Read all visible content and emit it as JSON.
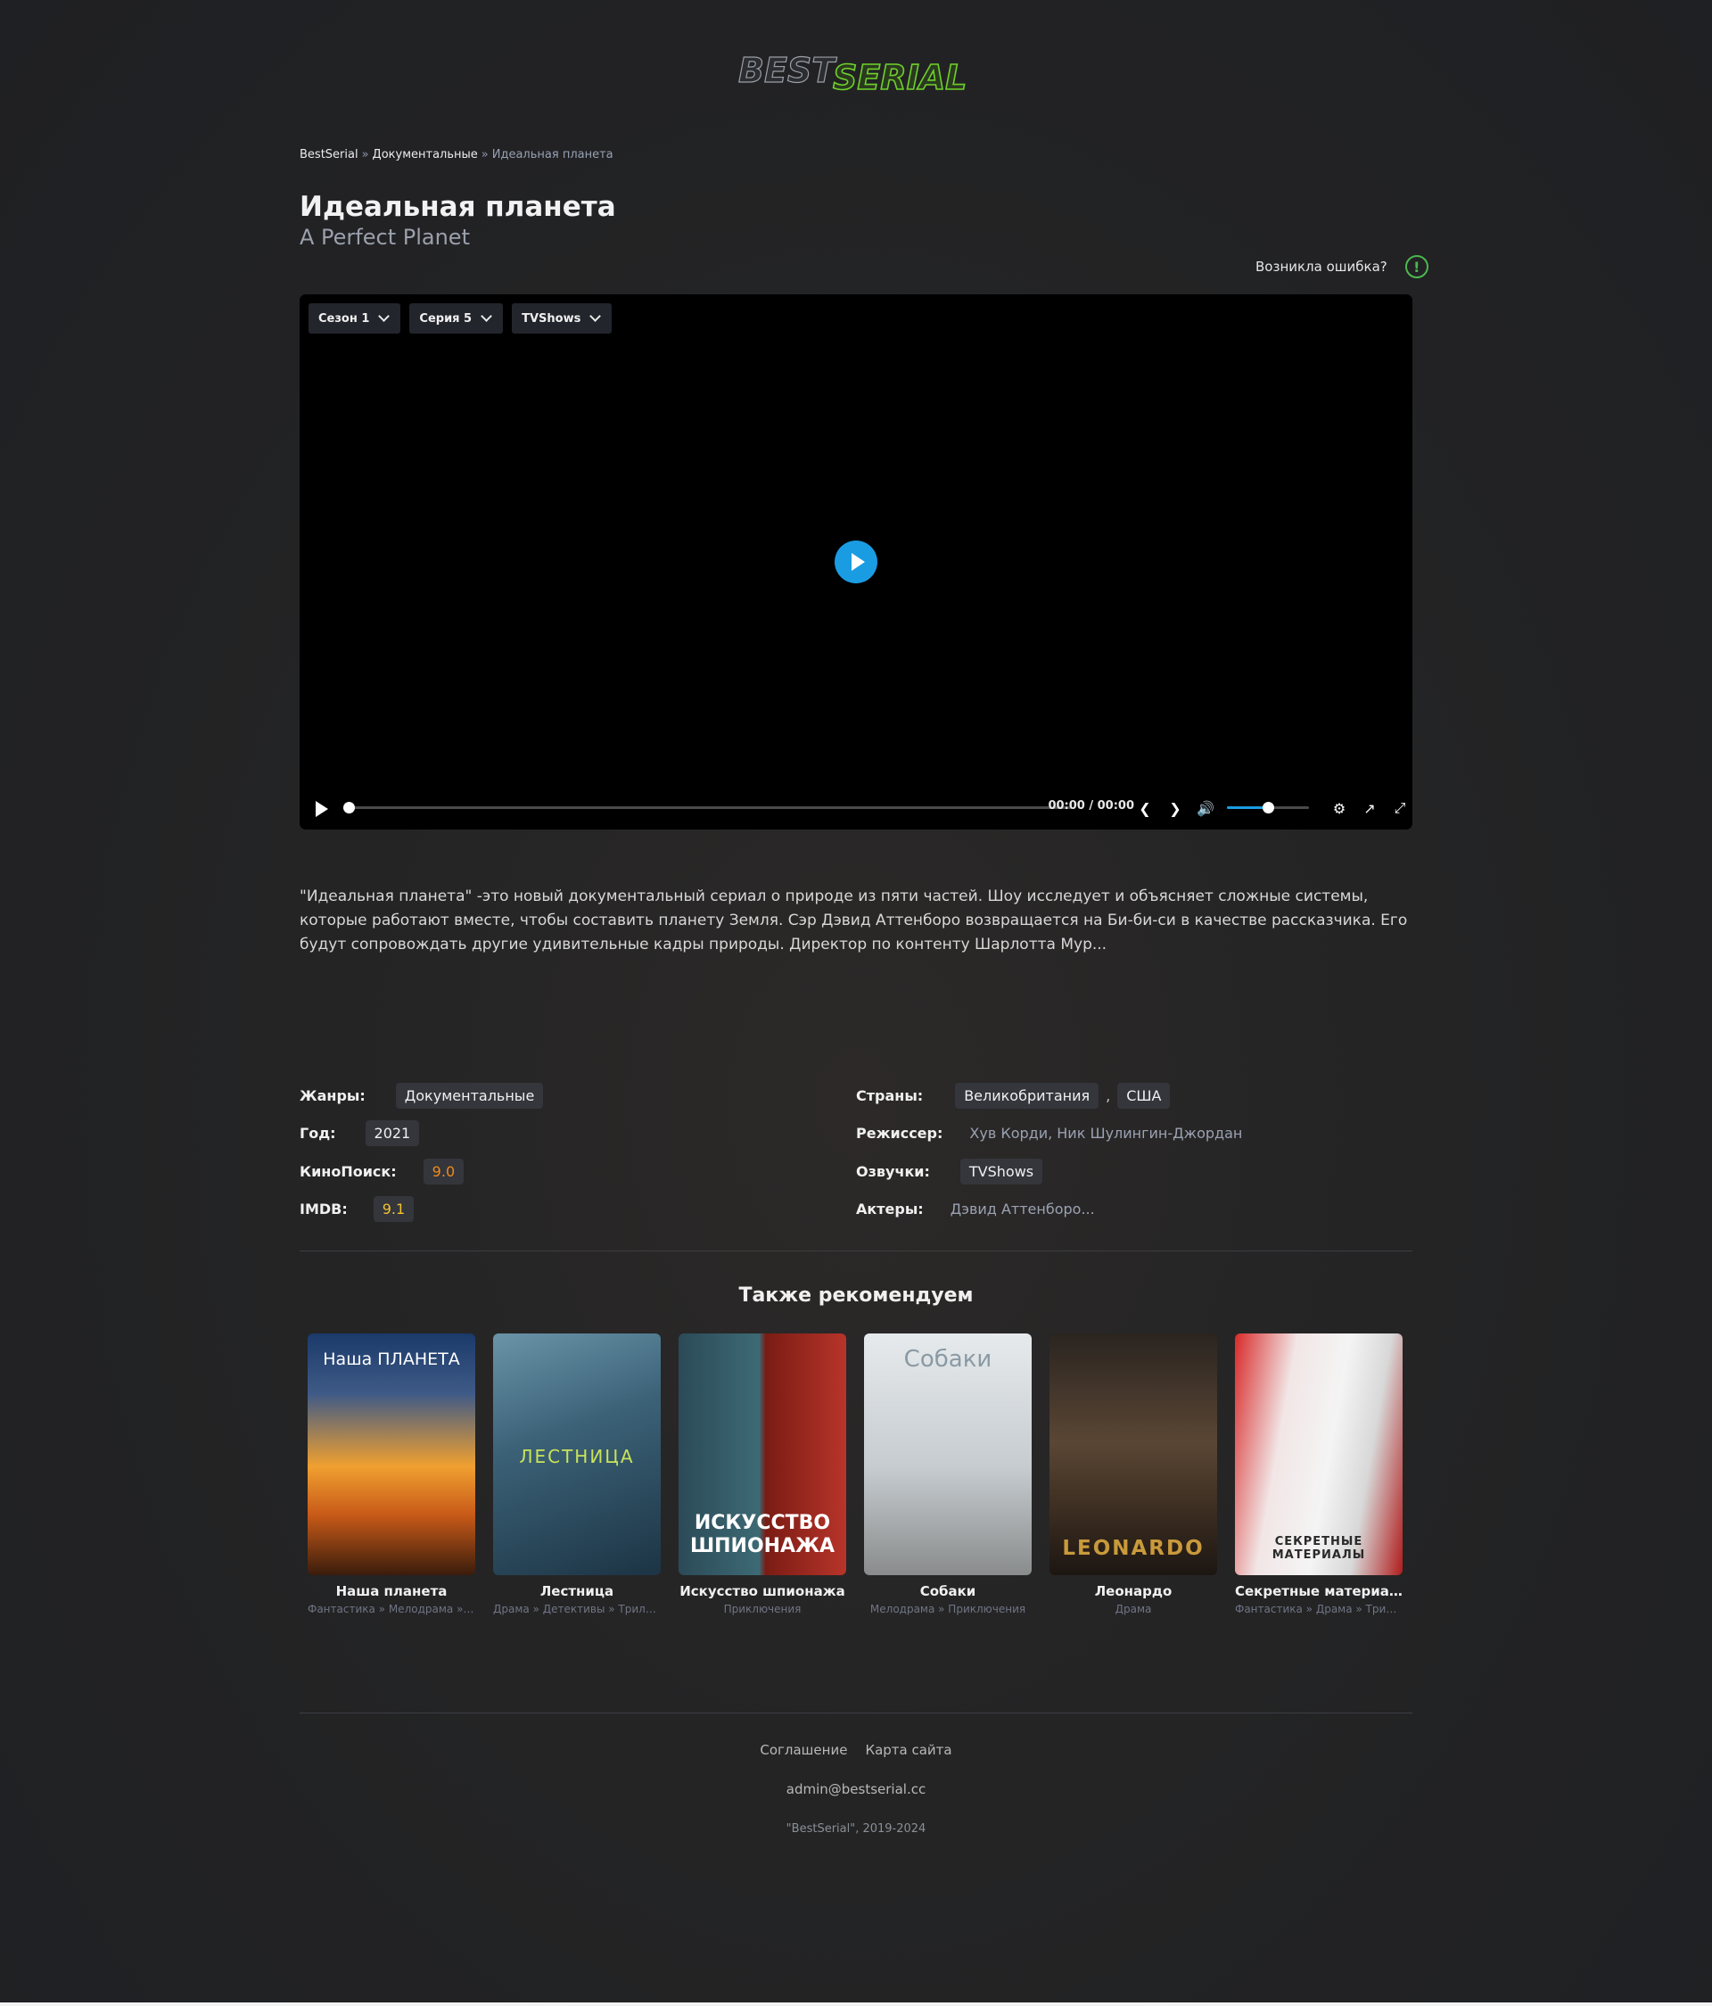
{
  "site": {
    "logo_left": "BEST",
    "logo_right": "SERIAL",
    "accent": "#4bb84f"
  },
  "breadcrumb": {
    "home": "BestSerial",
    "sep": "»",
    "category": "Документальные",
    "current": "Идеальная планета"
  },
  "title": "Идеальная планета",
  "original_title": "A Perfect Planet",
  "report": {
    "label": "Возникла ошибка?",
    "icon": "alert-circle-icon"
  },
  "player": {
    "season": "Сезон 1",
    "episode": "Серия 5",
    "voice": "TVShows",
    "time": "00:00 / 00:00",
    "progress": 0,
    "volume": 0.5,
    "accent": "#1a9ce3"
  },
  "description": "\"Идеальная планета\" -это новый документальный сериал о природе из пяти частей. Шоу исследует и объясняет сложные системы, которые работают вместе, чтобы составить планету Земля. Сэр Дэвид Аттенборо возвращается на Би-би-си в качестве рассказчика. Его будут сопровождать другие удивительные кадры природы. Директор по контенту Шарлотта Мур...",
  "info": {
    "genres_label": "Жанры:",
    "genre": "Документальные",
    "year_label": "Год:",
    "year": "2021",
    "kp_label": "КиноПоиск:",
    "kp": "9.0",
    "imdb_label": "IMDB:",
    "imdb": "9.1",
    "countries_label": "Страны:",
    "country1": "Великобритания",
    "country2": "США",
    "director_label": "Режиссер:",
    "director": "Хув Корди, Ник Шулингин-Джордан",
    "voice_label": "Озвучки:",
    "voice": "TVShows",
    "actors_label": "Актеры:",
    "actors": "Дэвид Аттенборо..."
  },
  "recommend": {
    "title": "Также рекомендуем",
    "items": [
      {
        "name": "Наша планета",
        "genres": "Фантастика » Мелодрама » ...",
        "poster_text": "Наша ПЛАНЕТА"
      },
      {
        "name": "Лестница",
        "genres": "Драма » Детективы » Трилле...",
        "poster_text": "ЛЕСТНИЦА"
      },
      {
        "name": "Искусство шпионажа",
        "genres": "Приключения",
        "poster_text": "ИСКУССТВО ШПИОНАЖА"
      },
      {
        "name": "Собаки",
        "genres": "Мелодрама » Приключения",
        "poster_text": "Собаки"
      },
      {
        "name": "Леонардо",
        "genres": "Драма",
        "poster_text": "LEONARDO"
      },
      {
        "name": "Секретные материалы",
        "genres": "Фантастика » Драма » Трилл...",
        "poster_text": "СЕКРЕТНЫЕ МАТЕРИАЛЫ"
      }
    ]
  },
  "footer": {
    "agreement": "Соглашение",
    "sitemap": "Карта сайта",
    "email": "admin@bestserial.cc",
    "copyright": "\"BestSerial\", 2019-2024"
  }
}
